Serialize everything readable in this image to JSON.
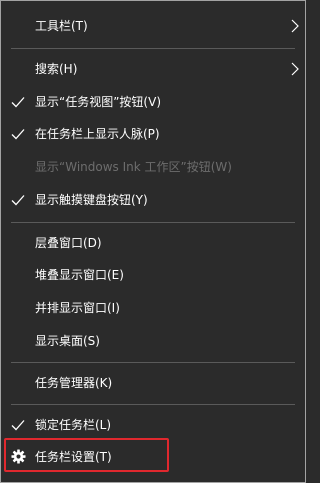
{
  "menu": {
    "toolbars": {
      "label": "工具栏(T)",
      "icon": "chevron-right-icon"
    },
    "search": {
      "label": "搜索(H)",
      "icon": "chevron-right-icon"
    },
    "show_task_view": {
      "label": "显示“任务视图”按钮(V)",
      "checked": true
    },
    "show_people": {
      "label": "在任务栏上显示人脉(P)",
      "checked": true
    },
    "show_ink": {
      "label": "显示“Windows Ink 工作区”按钮(W)",
      "enabled": false
    },
    "show_touch_keyboard": {
      "label": "显示触摸键盘按钮(Y)",
      "checked": true
    },
    "cascade": {
      "label": "层叠窗口(D)"
    },
    "stacked": {
      "label": "堆叠显示窗口(E)"
    },
    "side_by_side": {
      "label": "并排显示窗口(I)"
    },
    "show_desktop": {
      "label": "显示桌面(S)"
    },
    "task_manager": {
      "label": "任务管理器(K)"
    },
    "lock_taskbar": {
      "label": "锁定任务栏(L)",
      "checked": true
    },
    "taskbar_settings": {
      "label": "任务栏设置(T)",
      "icon": "gear-icon",
      "highlighted": true
    }
  },
  "colors": {
    "background": "#2b2b2b",
    "text": "#ffffff",
    "disabled_text": "#6d6d6d",
    "separator": "#5a5a5a",
    "highlight_border": "#e0282e"
  }
}
